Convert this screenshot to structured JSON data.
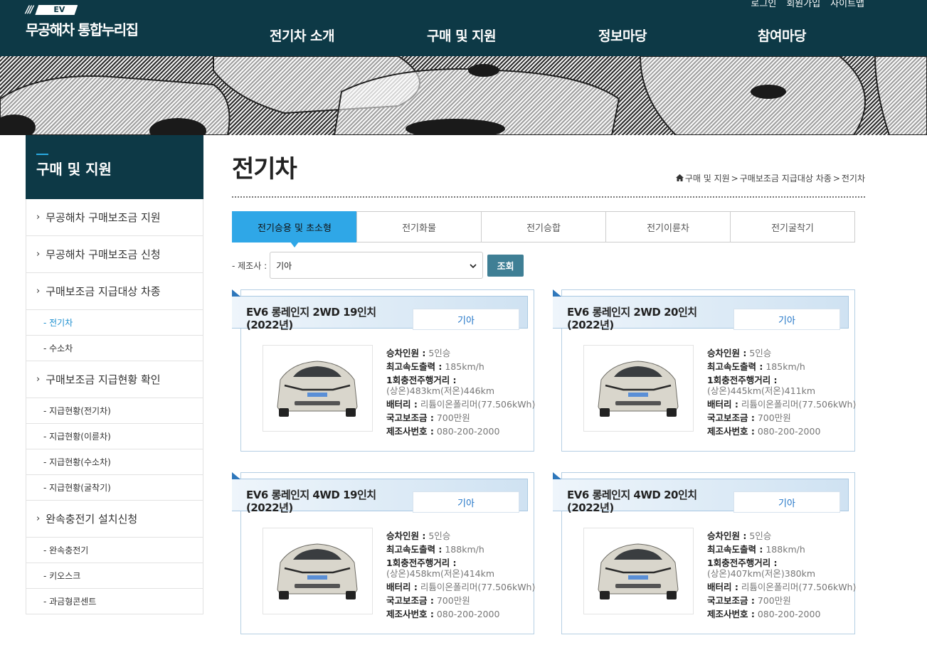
{
  "header": {
    "logo_badge": "EV",
    "logo_slashes": "///",
    "logo_text": "무공해차 통합누리집",
    "util": [
      "로그인",
      "회원가입",
      "사이트맵"
    ],
    "gnb": [
      "전기차 소개",
      "구매 및 지원",
      "정보마당",
      "참여마당"
    ]
  },
  "lnb": {
    "title": "구매 및 지원",
    "items": [
      {
        "label": "무공해차 구매보조금 지원"
      },
      {
        "label": "무공해차 구매보조금 신청"
      },
      {
        "label": "구매보조금 지급대상 차종"
      },
      {
        "label": "- 전기차"
      },
      {
        "label": "- 수소차"
      },
      {
        "label": "구매보조금 지급현황 확인"
      },
      {
        "label": "- 지급현황(전기차)"
      },
      {
        "label": "- 지급현황(이륜차)"
      },
      {
        "label": "- 지급현황(수소차)"
      },
      {
        "label": "- 지급현황(굴착기)"
      },
      {
        "label": "완속충전기 설치신청"
      },
      {
        "label": "- 완속충전기"
      },
      {
        "label": "- 키오스크"
      },
      {
        "label": "- 과금형콘센트"
      }
    ]
  },
  "page": {
    "title": "전기차",
    "breadcrumb": [
      "구매 및 지원",
      "구매보조금 지급대상 차종",
      "전기차"
    ]
  },
  "tabs": [
    "전기승용 및 초소형",
    "전기화물",
    "전기승합",
    "전기이륜차",
    "전기굴착기"
  ],
  "filter": {
    "label": "- 제조사 :",
    "selected": "기아",
    "button": "조회"
  },
  "spec_labels": {
    "seats": "승차인원 :",
    "speed": "최고속도출력 :",
    "range": "1회충전주행거리 :",
    "battery": "배터리 :",
    "subsidy": "국고보조금 :",
    "phone": "제조사번호 :"
  },
  "cars": [
    {
      "name": "EV6 롱레인지 2WD 19인치 (2022년)",
      "maker": "기아",
      "seats": "5인승",
      "speed": "185km/h",
      "range": "(상온)483km(저온)446km",
      "battery": "리튬이온폴리머(77.506kWh)",
      "subsidy": "700만원",
      "phone": "080-200-2000",
      "car_color": "#d9d6cc"
    },
    {
      "name": "EV6 롱레인지 2WD 20인치 (2022년)",
      "maker": "기아",
      "seats": "5인승",
      "speed": "185km/h",
      "range": "(상온)445km(저온)411km",
      "battery": "리튬이온폴리머(77.506kWh)",
      "subsidy": "700만원",
      "phone": "080-200-2000",
      "car_color": "#d9d6cc"
    },
    {
      "name": "EV6 롱레인지 4WD 19인치 (2022년)",
      "maker": "기아",
      "seats": "5인승",
      "speed": "188km/h",
      "range": "(상온)458km(저온)414km",
      "battery": "리튬이온폴리머(77.506kWh)",
      "subsidy": "700만원",
      "phone": "080-200-2000",
      "car_color": "#d9d6cc"
    },
    {
      "name": "EV6 롱레인지 4WD 20인치 (2022년)",
      "maker": "기아",
      "seats": "5인승",
      "speed": "188km/h",
      "range": "(상온)407km(저온)380km",
      "battery": "리튬이온폴리머(77.506kWh)",
      "subsidy": "700만원",
      "phone": "080-200-2000",
      "car_color": "#d9d6cc"
    }
  ],
  "colors": {
    "header_bg": "#0d3946",
    "tab_active": "#2fa7e7",
    "button": "#3f7f95",
    "link_active": "#1c8fd0"
  }
}
